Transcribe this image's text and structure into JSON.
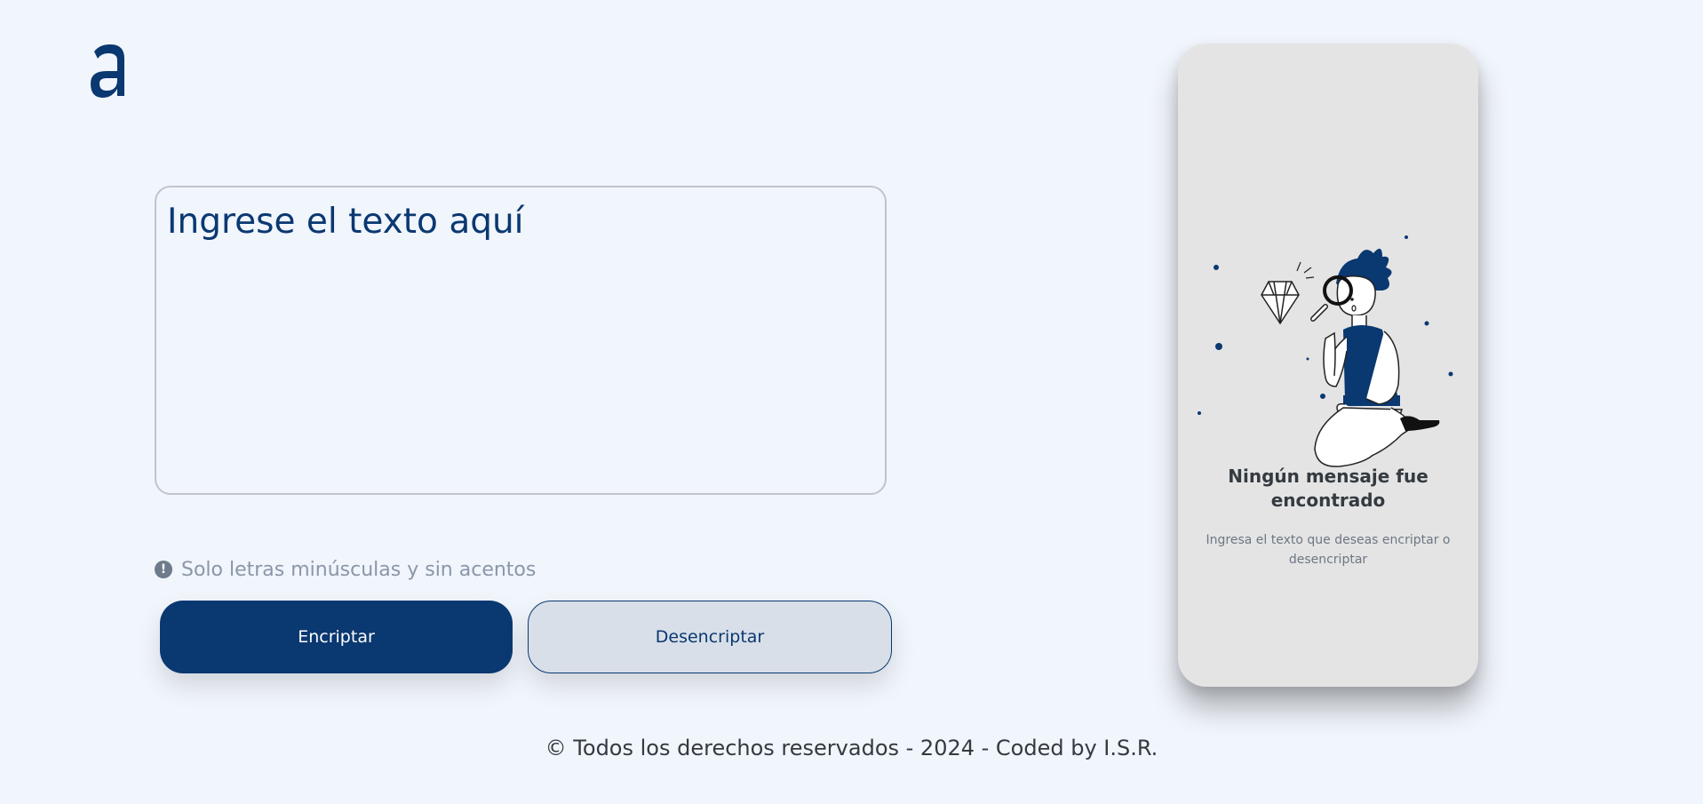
{
  "brand": {
    "logo_icon": "alura-a-logo",
    "accent_color": "#0a3871"
  },
  "input": {
    "placeholder": "Ingrese el texto aquí",
    "value": ""
  },
  "hint": {
    "icon": "exclamation-circle-icon",
    "text": "Solo letras minúsculas y sin acentos"
  },
  "buttons": {
    "encrypt_label": "Encriptar",
    "decrypt_label": "Desencriptar"
  },
  "output_panel": {
    "illustration": "person-with-magnifying-glass-and-diamond",
    "title": "Ningún mensaje fue encontrado",
    "subtitle": "Ingresa el texto que deseas encriptar o desencriptar"
  },
  "footer": {
    "text": "© Todos los derechos reservados - 2024 - Coded by I.S.R."
  }
}
